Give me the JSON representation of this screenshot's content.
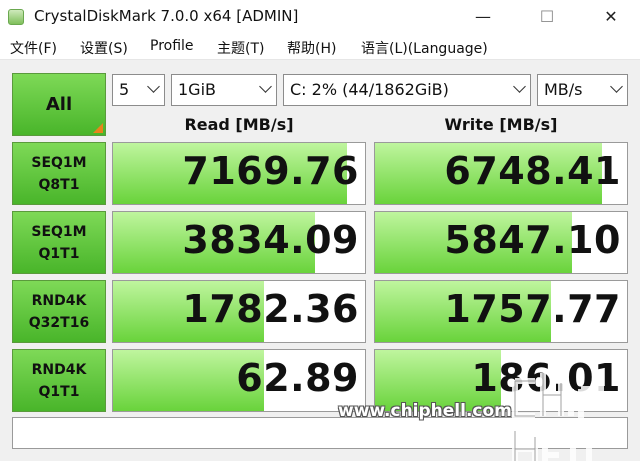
{
  "window": {
    "title": "CrystalDiskMark 7.0.0 x64 [ADMIN]",
    "minimize": "—",
    "maximize": "☐",
    "close": "✕"
  },
  "menu": [
    "文件(F)",
    "设置(S)",
    "Profile",
    "主题(T)",
    "帮助(H)",
    "语言(L)(Language)"
  ],
  "controls": {
    "all_label": "All",
    "count": "5",
    "size": "1GiB",
    "drive": "C: 2% (44/1862GiB)",
    "unit": "MB/s"
  },
  "headers": {
    "read": "Read [MB/s]",
    "write": "Write [MB/s]"
  },
  "rows": [
    {
      "line1": "SEQ1M",
      "line2": "Q8T1",
      "read": "7169.76",
      "write": "6748.41",
      "read_fill": 0.93,
      "write_fill": 0.9
    },
    {
      "line1": "SEQ1M",
      "line2": "Q1T1",
      "read": "3834.09",
      "write": "5847.10",
      "read_fill": 0.8,
      "write_fill": 0.78
    },
    {
      "line1": "RND4K",
      "line2": "Q32T16",
      "read": "1782.36",
      "write": "1757.77",
      "read_fill": 0.6,
      "write_fill": 0.7
    },
    {
      "line1": "RND4K",
      "line2": "Q1T1",
      "read": "62.89",
      "write": "186.01",
      "read_fill": 0.6,
      "write_fill": 0.5
    }
  ],
  "watermark": "www.chiphell.com",
  "colors": {
    "button_green": "#49b52a",
    "bar_green": "#69d33b",
    "corner_orange": "#e8831c"
  }
}
